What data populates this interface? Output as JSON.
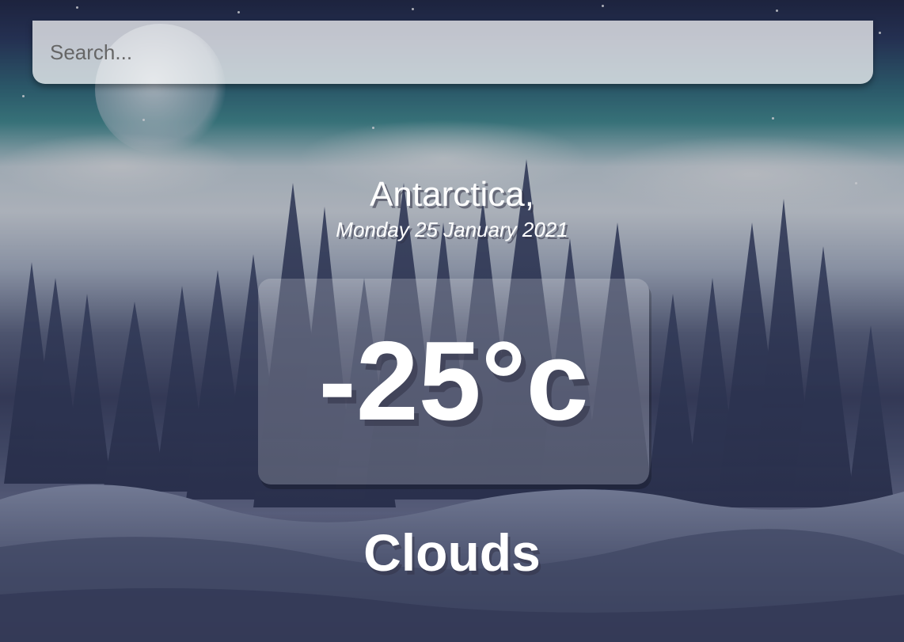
{
  "search": {
    "placeholder": "Search...",
    "value": ""
  },
  "location": {
    "city": "Antarctica,",
    "date": "Monday 25 January 2021"
  },
  "weather": {
    "temperature": "-25°c",
    "condition": "Clouds"
  },
  "colors": {
    "text": "#ffffff",
    "search_bg": "rgba(255,255,255,0.72)",
    "temp_box_bg": "rgba(255,255,255,0.2)"
  }
}
